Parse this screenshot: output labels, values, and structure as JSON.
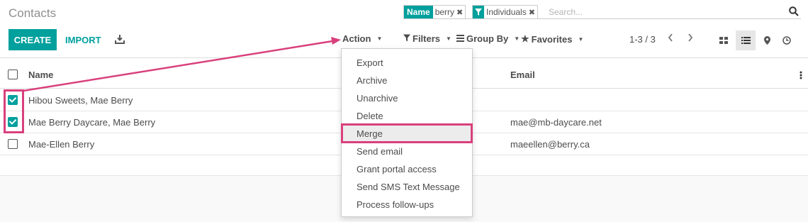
{
  "header": {
    "title": "Contacts"
  },
  "search": {
    "facets": [
      {
        "label": "Name",
        "value": "berry"
      },
      {
        "icon": "filter-icon",
        "value": "Individuals"
      }
    ],
    "placeholder": "Search...",
    "remove_glyph": "✖"
  },
  "toolbar": {
    "create_label": "CREATE",
    "import_label": "IMPORT",
    "action_label": "Action",
    "filters_label": "Filters",
    "groupby_label": "Group By",
    "favorites_label": "Favorites",
    "pager": "1-3 / 3"
  },
  "list": {
    "columns": [
      "Name",
      "Email"
    ],
    "rows": [
      {
        "name": "Hibou Sweets, Mae Berry",
        "email": "",
        "checked": true
      },
      {
        "name": "Mae Berry Daycare, Mae Berry",
        "email": "mae@mb-daycare.net",
        "checked": true
      },
      {
        "name": "Mae-Ellen Berry",
        "email": "maeellen@berry.ca",
        "checked": false
      }
    ]
  },
  "action_menu": {
    "items": [
      "Export",
      "Archive",
      "Unarchive",
      "Delete",
      "Merge",
      "Send email",
      "Grant portal access",
      "Send SMS Text Message",
      "Process follow-ups"
    ],
    "highlighted": "Merge"
  },
  "colors": {
    "accent": "#00A09D",
    "annotation": "#d9407d"
  }
}
